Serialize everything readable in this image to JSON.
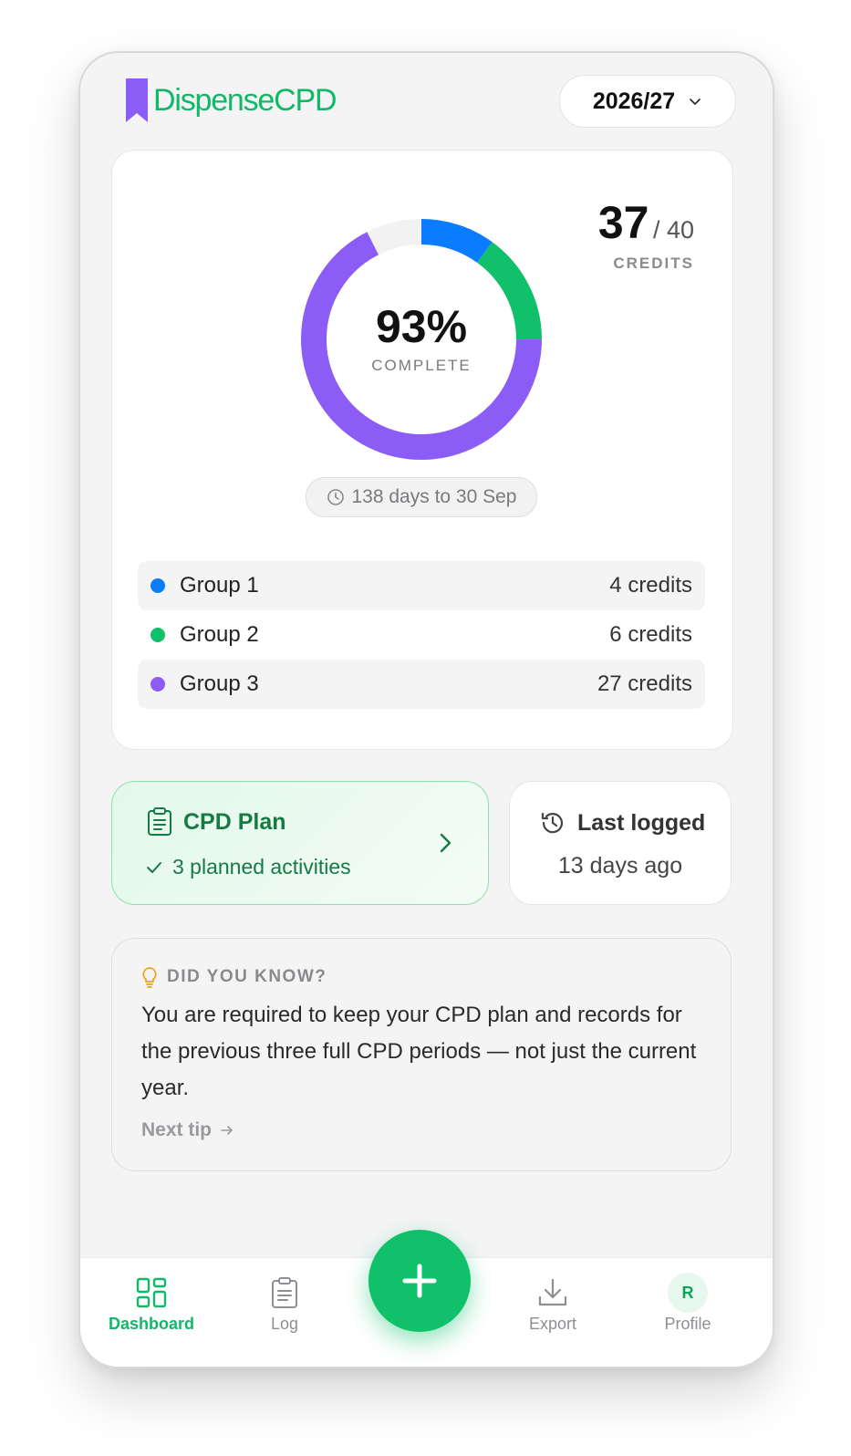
{
  "header": {
    "brand_first": "Dispense",
    "brand_second": "CPD",
    "period": "2026/27"
  },
  "summary": {
    "credits_earned": "37",
    "credits_target": "/ 40",
    "credits_label": "CREDITS",
    "percent": "93%",
    "percent_label": "COMPLETE",
    "days_left": "138 days to 30 Sep",
    "colors": {
      "group1": "#0a7cff",
      "group2": "#10c06a",
      "group3": "#8b5cf6",
      "remaining": "#f2f2f3"
    },
    "groups": [
      {
        "name": "Group 1",
        "credits": "4 credits",
        "value": 4
      },
      {
        "name": "Group 2",
        "credits": "6 credits",
        "value": 6
      },
      {
        "name": "Group 3",
        "credits": "27 credits",
        "value": 27
      }
    ],
    "target_value": 40
  },
  "plan": {
    "title": "CPD Plan",
    "subtitle": "3 planned activities",
    "icon": "clipboard-icon"
  },
  "last_logged": {
    "title": "Last logged",
    "value": "13 days ago",
    "icon": "history-icon"
  },
  "tip": {
    "heading": "DID YOU KNOW?",
    "body": "You are required to keep your CPD plan and records for the previous three full CPD periods — not just the current year.",
    "next": "Next tip"
  },
  "nav": {
    "dashboard": "Dashboard",
    "log": "Log",
    "export": "Export",
    "profile": "Profile",
    "avatar_initial": "R"
  }
}
